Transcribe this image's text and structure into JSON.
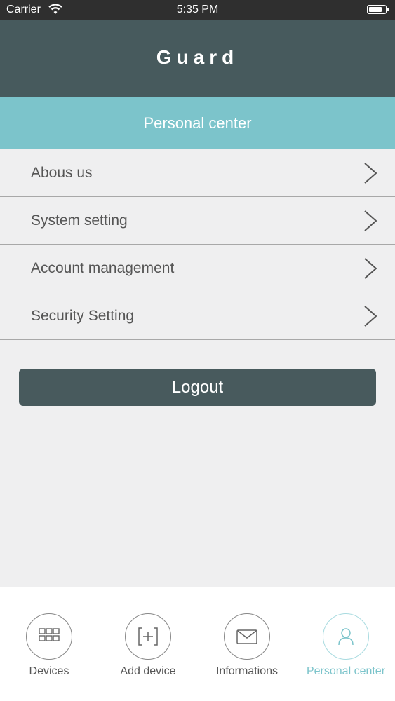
{
  "status_bar": {
    "carrier": "Carrier",
    "time": "5:35 PM"
  },
  "header": {
    "title": "Guard"
  },
  "section": {
    "title": "Personal center"
  },
  "menu": {
    "items": [
      {
        "label": "Abous us",
        "icon": "chevron-right-icon"
      },
      {
        "label": "System setting",
        "icon": "chevron-right-icon"
      },
      {
        "label": "Account management",
        "icon": "chevron-right-icon"
      },
      {
        "label": "Security Setting",
        "icon": "chevron-right-icon"
      }
    ]
  },
  "logout": {
    "label": "Logout"
  },
  "tabs": {
    "items": [
      {
        "label": "Devices",
        "icon": "grid-icon"
      },
      {
        "label": "Add device",
        "icon": "add-box-icon"
      },
      {
        "label": "Informations",
        "icon": "envelope-icon"
      },
      {
        "label": "Personal center",
        "icon": "person-icon",
        "active": true
      }
    ]
  },
  "colors": {
    "header_bg": "#475a5d",
    "section_bg": "#7cc4cb",
    "button_bg": "#485a5d",
    "active_tab": "#7cc4cb"
  }
}
